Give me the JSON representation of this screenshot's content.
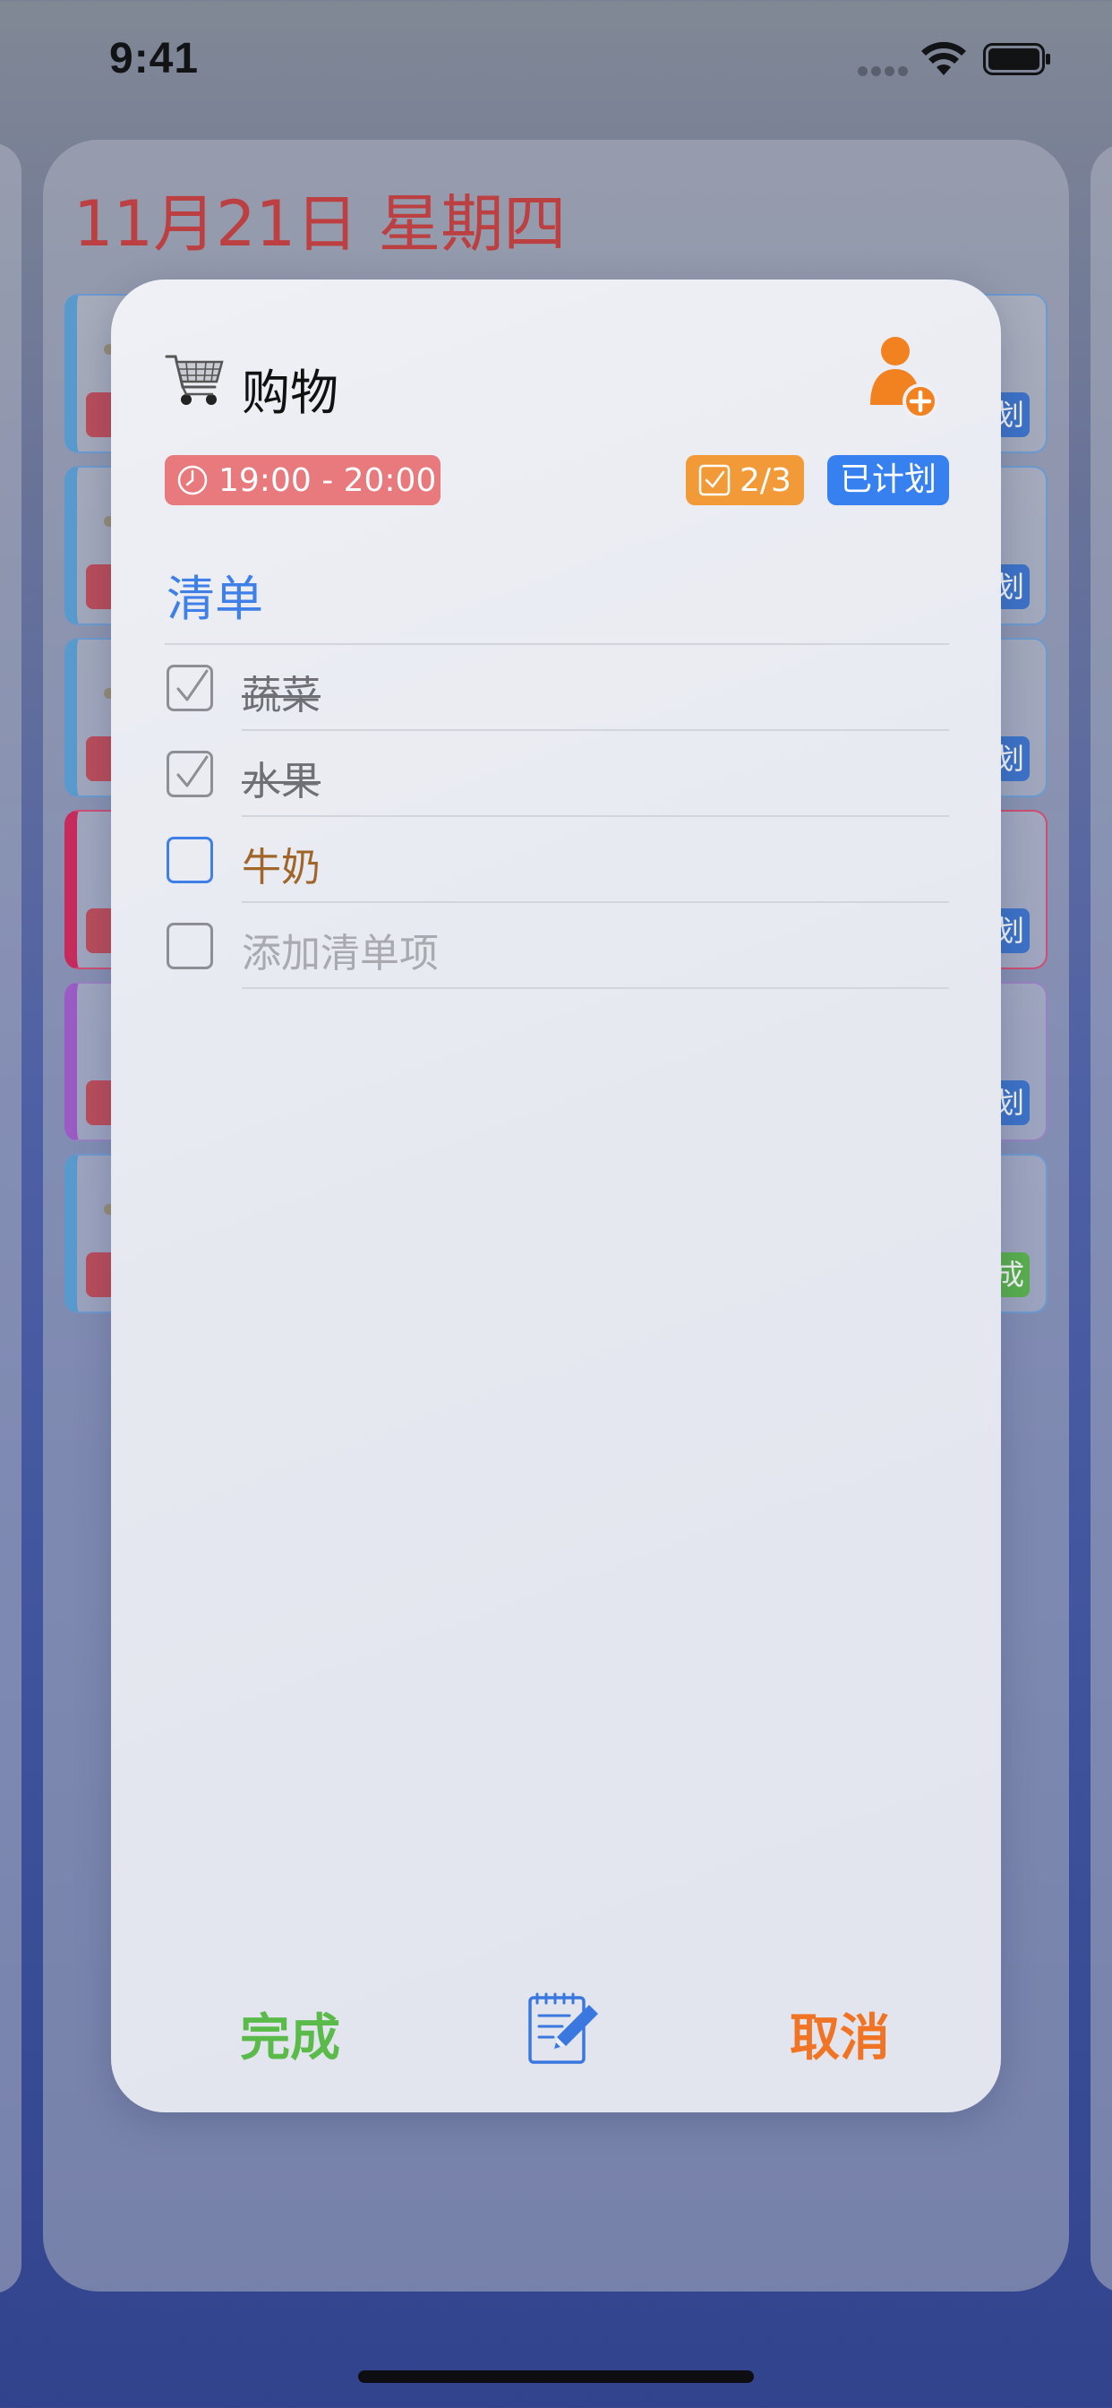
{
  "status_bar": {
    "time": "9:41"
  },
  "background": {
    "date_header": "11月21日 星期四",
    "rows": [
      {
        "badge": "划",
        "tone": "blue"
      },
      {
        "badge": "划",
        "tone": "blue"
      },
      {
        "badge": "划",
        "tone": "blue"
      },
      {
        "badge": "划",
        "tone": "red"
      },
      {
        "badge": "划",
        "tone": "purple"
      },
      {
        "badge": "成",
        "tone": "blue"
      }
    ]
  },
  "modal": {
    "title": "购物",
    "time_range": "19:00 - 20:00",
    "progress": "2/3",
    "status": "已计划",
    "list_heading": "清单",
    "items": [
      {
        "text": "蔬菜",
        "checked": true
      },
      {
        "text": "水果",
        "checked": true
      },
      {
        "text": "牛奶",
        "checked": false
      }
    ],
    "add_item_placeholder": "添加清单项",
    "done_label": "完成",
    "cancel_label": "取消"
  },
  "colors": {
    "accent_blue": "#3f7fe8",
    "done_green": "#5bbb4a",
    "cancel_orange": "#f07423",
    "time_badge": "#e8797c",
    "progress_badge": "#f39a38",
    "status_badge": "#3780ef"
  },
  "icons": [
    "cart-icon",
    "add-person-icon",
    "clock-icon",
    "checkbox-icon",
    "edit-icon",
    "wifi-icon",
    "battery-icon"
  ]
}
